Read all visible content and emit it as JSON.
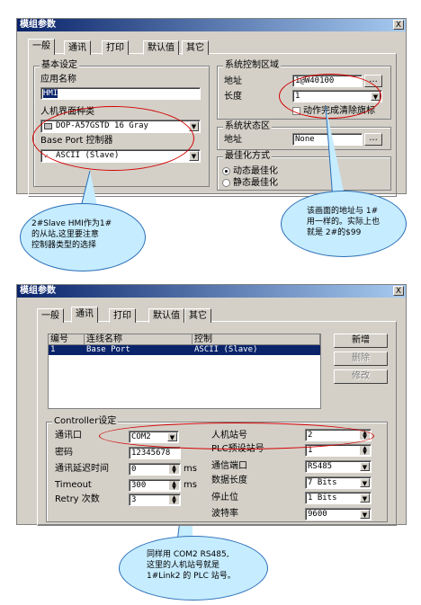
{
  "window1": {
    "title": "模组参数",
    "close": "X",
    "tabs": [
      "一般",
      "通讯",
      "打印",
      "默认值",
      "其它"
    ],
    "basic_group": {
      "title": "基本设定",
      "app_name_label": "应用名称",
      "app_name_value": "HMI",
      "hmi_type_label": "人机界面种类",
      "hmi_type_value": "DOP-A57GSTD 16 Gray",
      "base_port_label": "Base Port 控制器",
      "base_port_value": "ASCII (Slave)"
    },
    "sys_ctrl_group": {
      "title": "系统控制区域",
      "addr_label": "地址",
      "addr_value": "1@W40100",
      "len_label": "长度",
      "len_value": "1",
      "auto_clear_label": "动作完成清除旗标"
    },
    "sys_status_group": {
      "title": "系统状态区",
      "addr_label": "地址",
      "addr_value": "None"
    },
    "opt_group": {
      "title": "最佳化方式",
      "dynamic_label": "动态最佳化",
      "static_label": "静态最佳化"
    },
    "ellipsis": "..."
  },
  "callout1": "2#Slave HMI作为1#\n的从站,这里要注意\n控制器类型的选择",
  "callout2": "该画面的地址与 1#\n用一样的。实际上也\n就是 2#的$99",
  "window2": {
    "title": "模组参数",
    "close": "X",
    "tabs": [
      "一般",
      "通讯",
      "打印",
      "默认值",
      "其它"
    ],
    "list": {
      "headers": [
        "编号",
        "连线名称",
        "控制"
      ],
      "row": [
        "1",
        "Base Port",
        "ASCII (Slave)"
      ]
    },
    "buttons": {
      "add": "新增",
      "delete": "删除",
      "modify": "修改"
    },
    "controller_group": {
      "title": "Controller设定",
      "comm_port_label": "通讯口",
      "comm_port_value": "COM2",
      "password_label": "密码",
      "password_value": "12345678",
      "delay_label": "通讯延迟时间",
      "delay_value": "0",
      "timeout_label": "Timeout",
      "timeout_value": "300",
      "retry_label": "Retry 次数",
      "retry_value": "3",
      "ms1": "ms",
      "ms2": "ms",
      "hmi_station_label": "人机站号",
      "hmi_station_value": "2",
      "plc_station_label": "PLC预设站号",
      "plc_station_value": "1",
      "port_type_label": "通信端口",
      "port_type_value": "RS485",
      "data_len_label": "数据长度",
      "data_len_value": "7 Bits",
      "stop_bits_label": "停止位",
      "stop_bits_value": "1 Bits",
      "baud_label": "波特率",
      "baud_value": "9600"
    }
  },
  "callout3": "同样用 COM2 RS485,\n这里的人机站号就是\n1#Link2 的 PLC 站号。"
}
